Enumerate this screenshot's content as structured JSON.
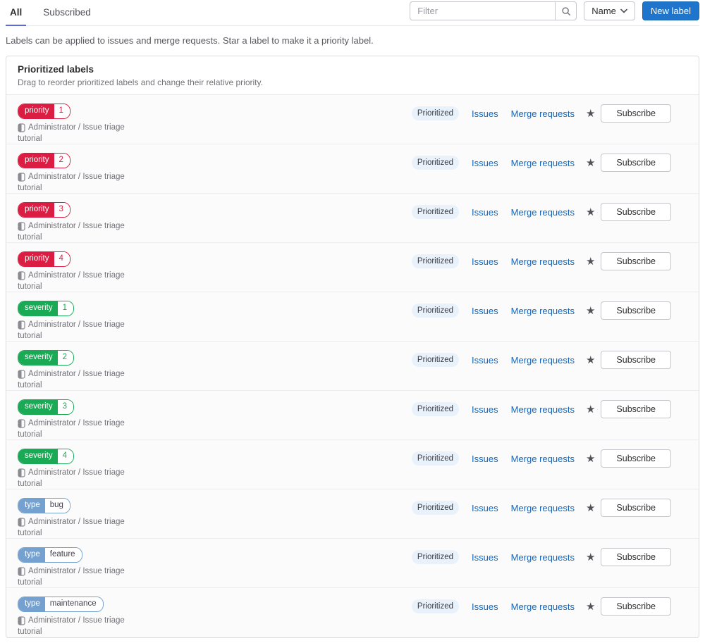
{
  "tabs": [
    {
      "label": "All",
      "active": true
    },
    {
      "label": "Subscribed",
      "active": false
    }
  ],
  "toolbar": {
    "filter_placeholder": "Filter",
    "sort_label": "Name",
    "new_label_button": "New label"
  },
  "description": "Labels can be applied to issues and merge requests. Star a label to make it a priority label.",
  "card": {
    "title": "Prioritized labels",
    "subtitle": "Drag to reorder prioritized labels and change their relative priority."
  },
  "row_shared": {
    "project_line": "Administrator / Issue triage",
    "project_line2": "tutorial",
    "prioritized_badge": "Prioritized",
    "issues_link": "Issues",
    "merge_requests_link": "Merge requests",
    "subscribe_button": "Subscribe",
    "star_icon": "★"
  },
  "label_colors": {
    "red": {
      "bg": "#dc1d43",
      "fg": "#ffffff",
      "value_fg": "#dc1d43"
    },
    "green": {
      "bg": "#1aaa55",
      "fg": "#ffffff",
      "value_fg": "#1aaa55"
    },
    "blue": {
      "bg": "#75a1d0",
      "fg": "#ffffff",
      "value_fg": "#45424d"
    }
  },
  "labels": [
    {
      "scope": "priority",
      "value": "1",
      "color": "red"
    },
    {
      "scope": "priority",
      "value": "2",
      "color": "red"
    },
    {
      "scope": "priority",
      "value": "3",
      "color": "red"
    },
    {
      "scope": "priority",
      "value": "4",
      "color": "red"
    },
    {
      "scope": "severity",
      "value": "1",
      "color": "green"
    },
    {
      "scope": "severity",
      "value": "2",
      "color": "green"
    },
    {
      "scope": "severity",
      "value": "3",
      "color": "green"
    },
    {
      "scope": "severity",
      "value": "4",
      "color": "green"
    },
    {
      "scope": "type",
      "value": "bug",
      "color": "blue"
    },
    {
      "scope": "type",
      "value": "feature",
      "color": "blue"
    },
    {
      "scope": "type",
      "value": "maintenance",
      "color": "blue"
    }
  ]
}
